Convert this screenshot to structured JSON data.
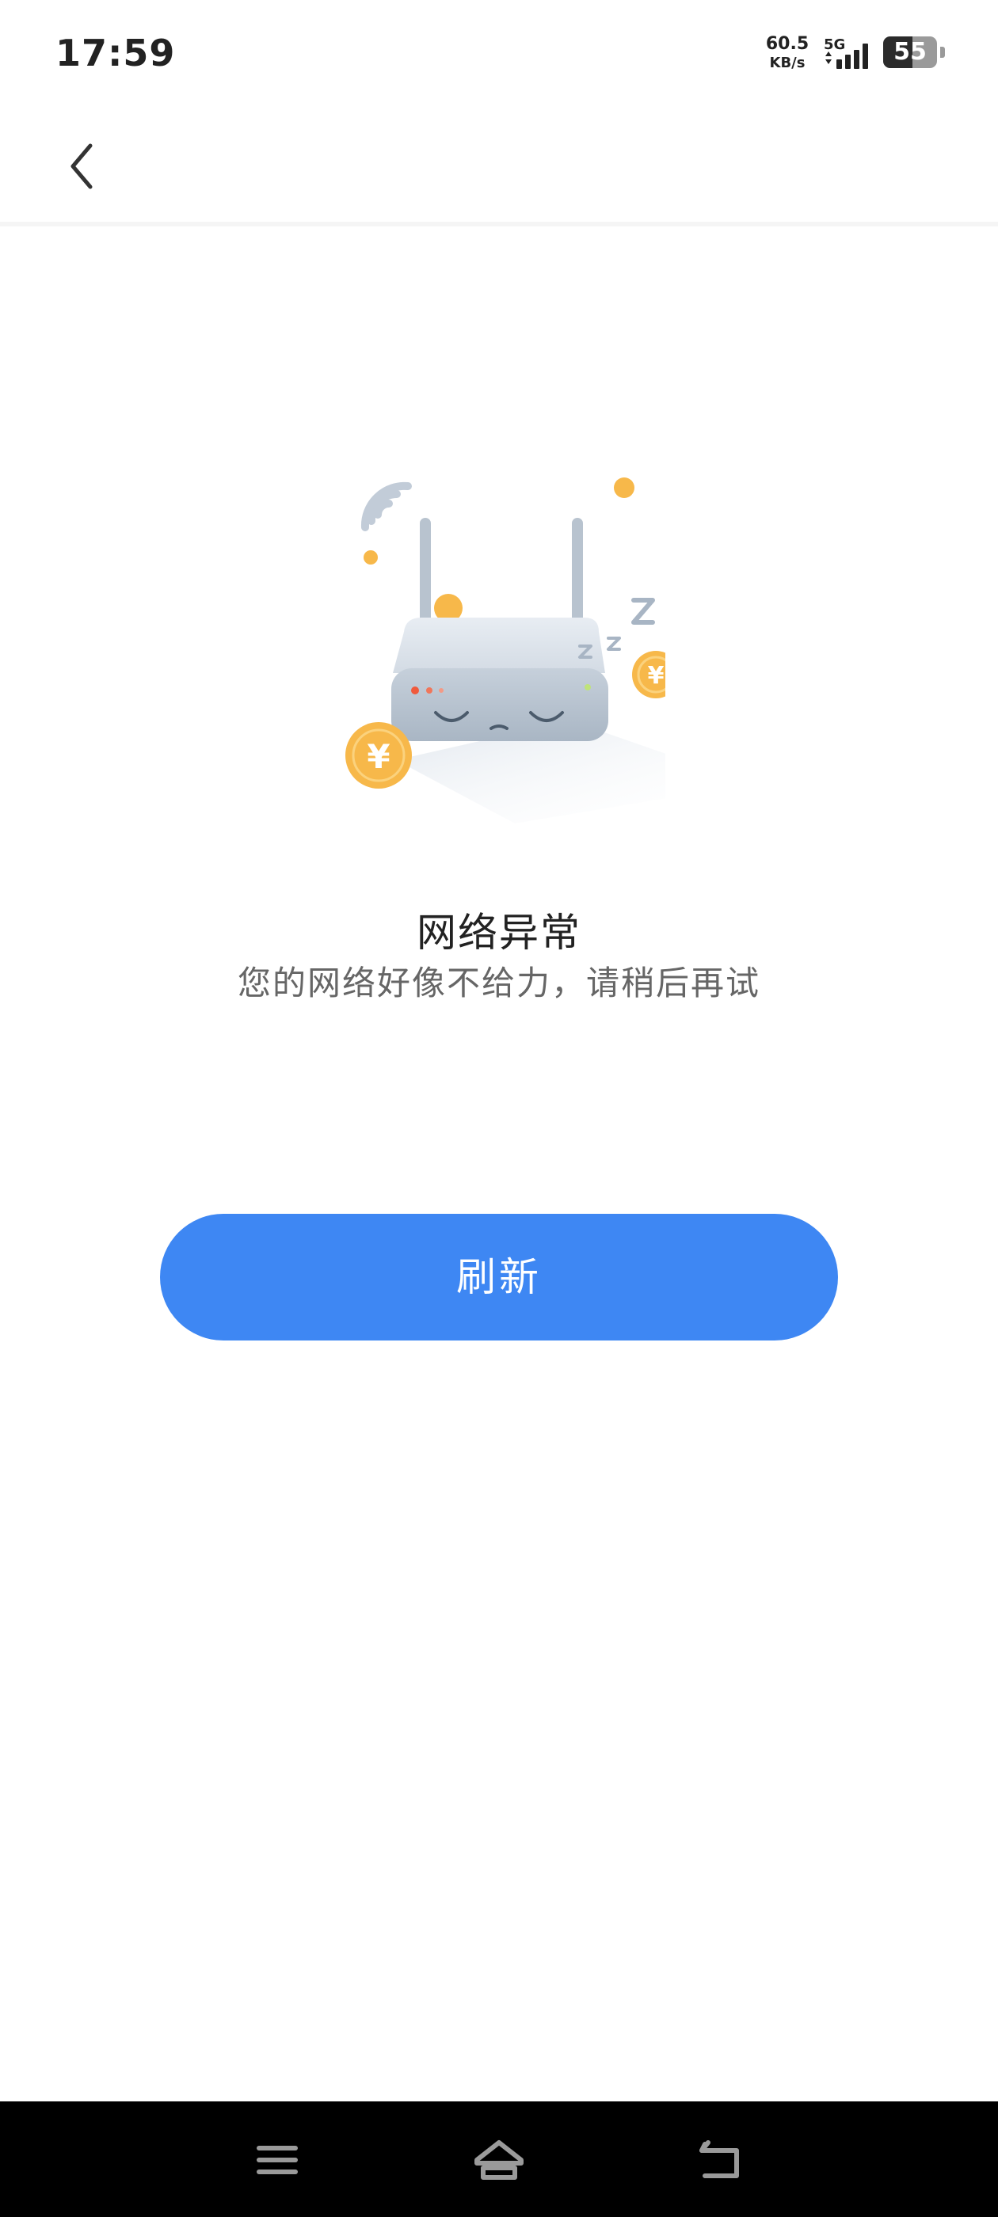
{
  "status_bar": {
    "time": "17:59",
    "net_speed_value": "60.5",
    "net_speed_unit": "KB/s",
    "network_type": "5G",
    "signal_bars": 4,
    "battery_level": "55",
    "battery_fraction": 0.55
  },
  "nav": {
    "back_icon": "chevron-left-icon"
  },
  "illustration": {
    "icon": "sleeping-router-icon",
    "coin_symbol": "¥",
    "sleep_letters": [
      "Z",
      "z",
      "z"
    ]
  },
  "error": {
    "title": "网络异常",
    "subtitle": "您的网络好像不给力，请稍后再试"
  },
  "actions": {
    "refresh_label": "刷新"
  },
  "system_nav": {
    "menu_icon": "menu-icon",
    "home_icon": "home-icon",
    "back_icon": "back-arrow-icon"
  },
  "colors": {
    "accent": "#3e87f3",
    "coin": "#f7b84a",
    "router": "#c9d2dc"
  }
}
